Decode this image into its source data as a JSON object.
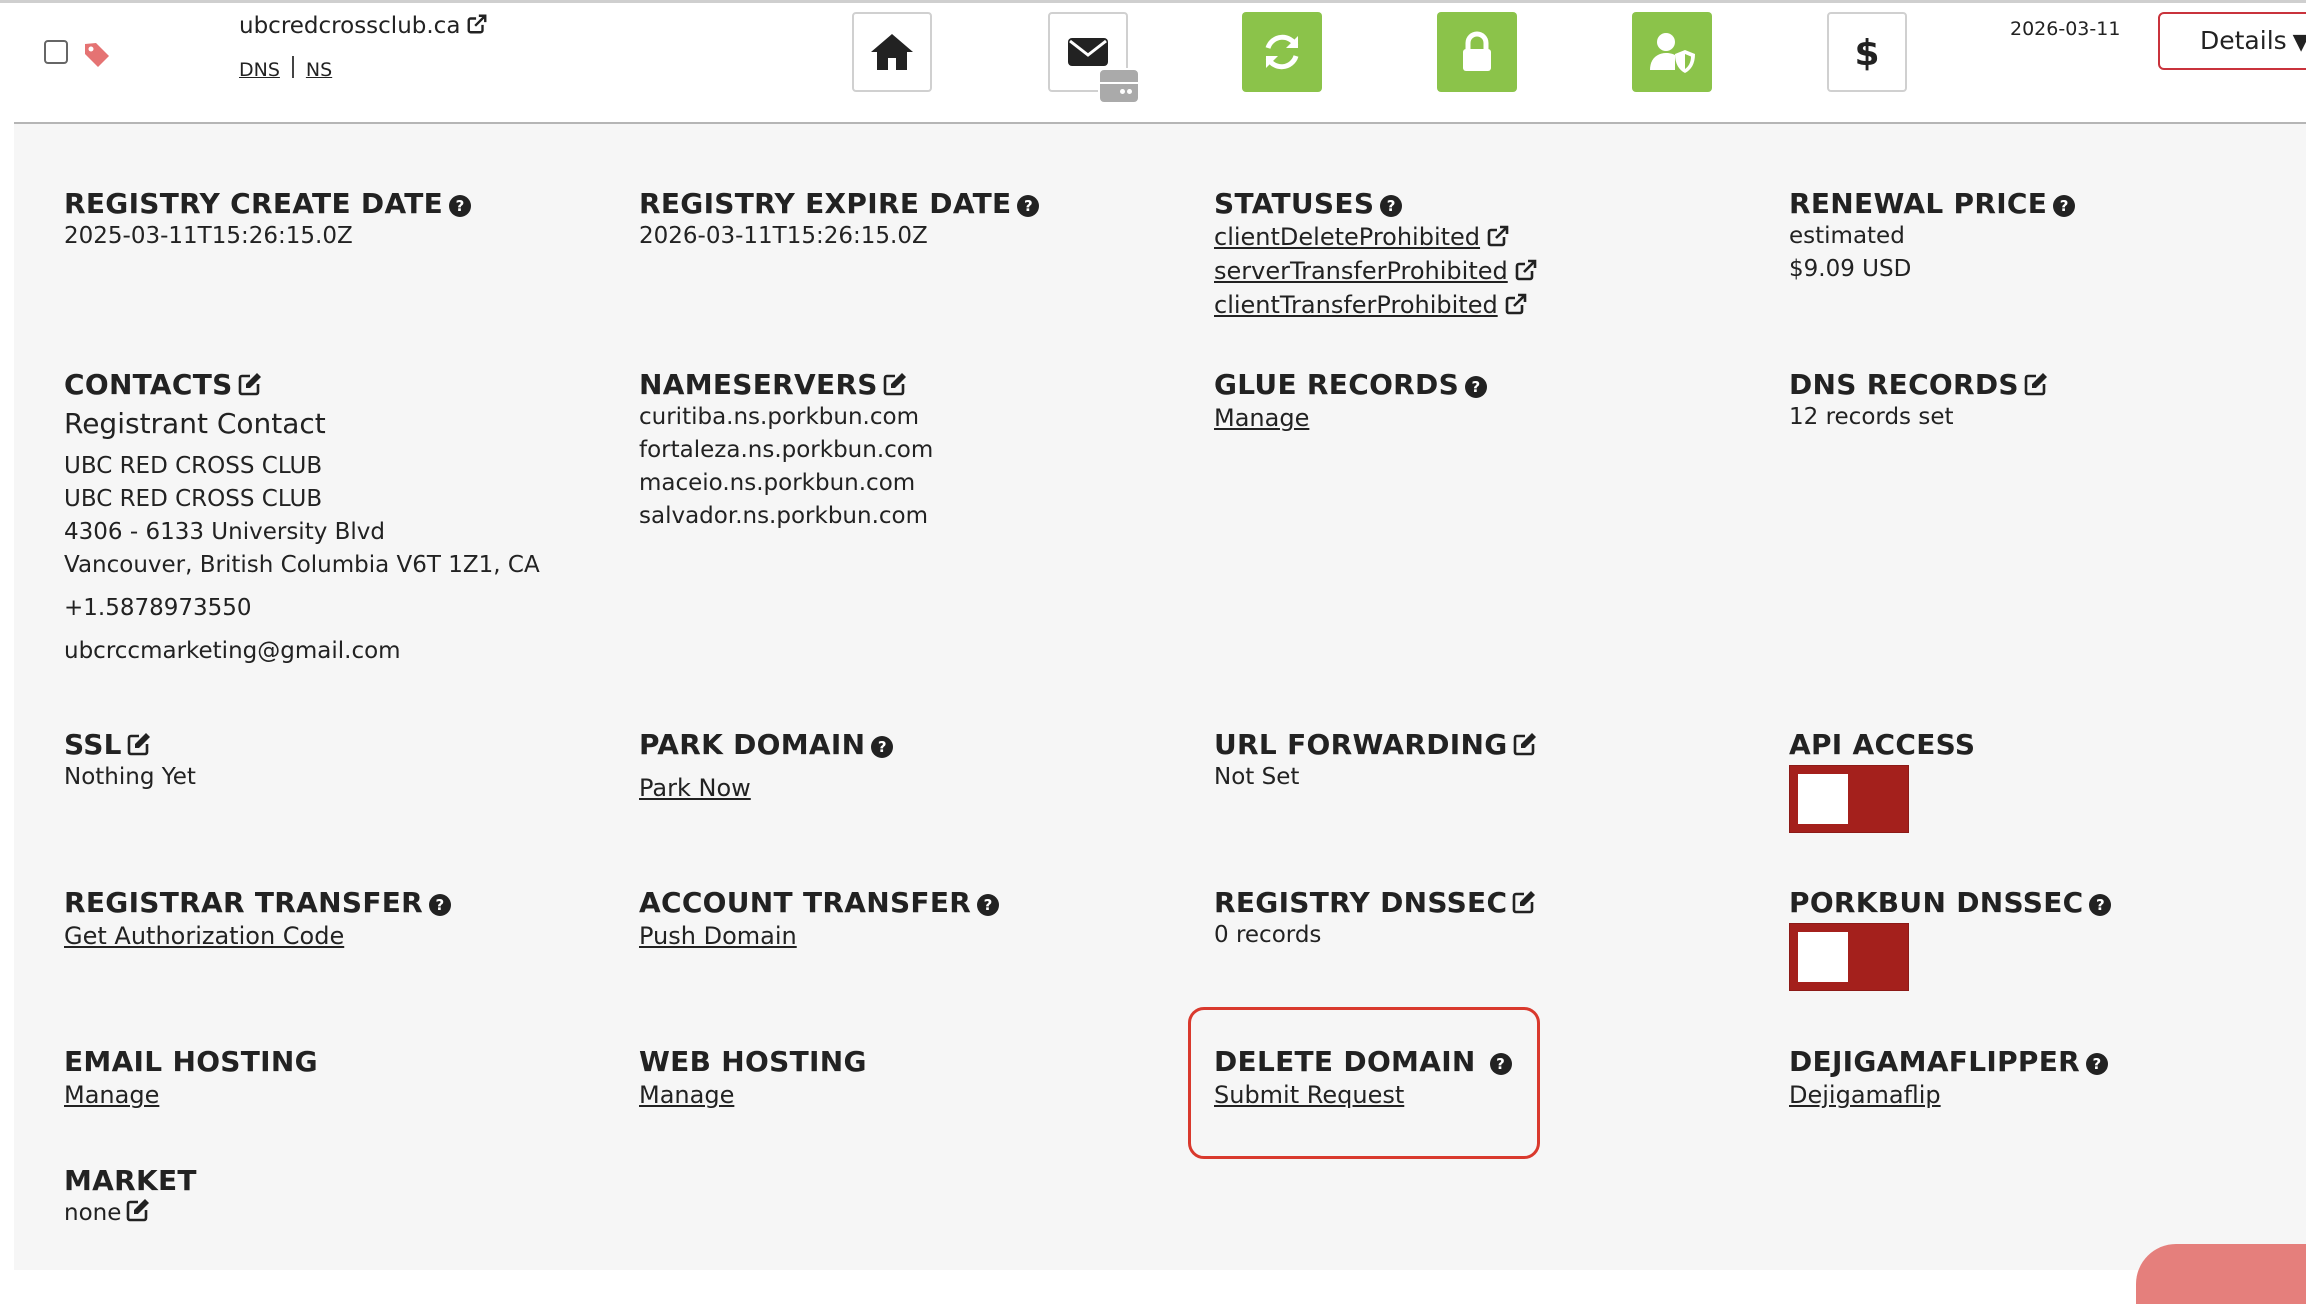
{
  "domain_row": {
    "domain": "ubcredcrossclub.ca",
    "links": [
      "DNS",
      "NS"
    ],
    "date": "2026-03-11",
    "details_label": "Details",
    "colors": {
      "green": "#8bc34a",
      "toggle_red": "#a4201c",
      "highlight": "#d9392d",
      "tag": "#e57373"
    }
  },
  "details": {
    "registry_create": {
      "label": "REGISTRY CREATE DATE",
      "value": "2025-03-11T15:26:15.0Z"
    },
    "registry_expire": {
      "label": "REGISTRY EXPIRE DATE",
      "value": "2026-03-11T15:26:15.0Z"
    },
    "statuses": {
      "label": "STATUSES",
      "items": [
        "clientDeleteProhibited",
        "serverTransferProhibited",
        "clientTransferProhibited"
      ]
    },
    "renewal_price": {
      "label": "RENEWAL PRICE",
      "note": "estimated",
      "price": "$9.09 USD"
    },
    "contacts": {
      "label": "CONTACTS",
      "type": "Registrant Contact",
      "lines": [
        "UBC RED CROSS CLUB",
        "UBC RED CROSS CLUB",
        "4306 - 6133 University Blvd",
        "Vancouver, British Columbia V6T 1Z1, CA"
      ],
      "phone": "+1.5878973550",
      "email": "ubcrccmarketing@gmail.com"
    },
    "nameservers": {
      "label": "NAMESERVERS",
      "items": [
        "curitiba.ns.porkbun.com",
        "fortaleza.ns.porkbun.com",
        "maceio.ns.porkbun.com",
        "salvador.ns.porkbun.com"
      ]
    },
    "glue_records": {
      "label": "GLUE RECORDS",
      "link": "Manage"
    },
    "dns_records": {
      "label": "DNS RECORDS",
      "value": "12 records set"
    },
    "ssl": {
      "label": "SSL",
      "value": "Nothing Yet"
    },
    "park_domain": {
      "label": "PARK DOMAIN",
      "link": "Park Now"
    },
    "url_forwarding": {
      "label": "URL FORWARDING",
      "value": "Not Set"
    },
    "api_access": {
      "label": "API ACCESS",
      "enabled": false
    },
    "registrar_transfer": {
      "label": "REGISTRAR TRANSFER",
      "link": "Get Authorization Code"
    },
    "account_transfer": {
      "label": "ACCOUNT TRANSFER",
      "link": "Push Domain"
    },
    "registry_dnssec": {
      "label": "REGISTRY DNSSEC",
      "value": "0 records"
    },
    "porkbun_dnssec": {
      "label": "PORKBUN DNSSEC",
      "enabled": false
    },
    "email_hosting": {
      "label": "EMAIL HOSTING",
      "link": "Manage"
    },
    "web_hosting": {
      "label": "WEB HOSTING",
      "link": "Manage"
    },
    "delete_domain": {
      "label": "DELETE DOMAIN",
      "link": "Submit Request"
    },
    "dejigamaflipper": {
      "label": "DEJIGAMAFLIPPER",
      "link": "Dejigamaflip"
    },
    "market": {
      "label": "MARKET",
      "value": "none"
    }
  }
}
